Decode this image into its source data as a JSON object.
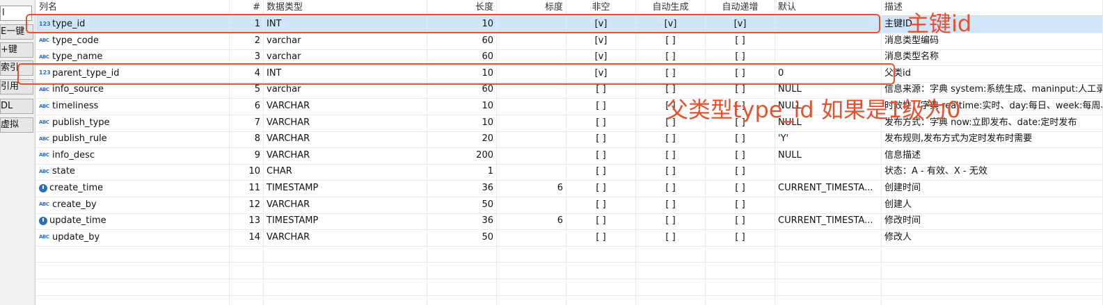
{
  "sidebar": {
    "field_value": "l",
    "items": [
      "E一键",
      "+键",
      "索引",
      "引用",
      "DL",
      "虚拟"
    ]
  },
  "columns": [
    "列名",
    "#",
    "数据类型",
    "长度",
    "标度",
    "非空",
    "自动生成",
    "自动递增",
    "默认",
    "描述"
  ],
  "rows": [
    {
      "icon": "number-type-icon",
      "name": "type_id",
      "num": "1",
      "type": "INT",
      "length": "10",
      "scale": "",
      "notnull": "[v]",
      "autogen": "[v]",
      "autoinc": "[v]",
      "default": "",
      "desc": "主键ID",
      "selected": true
    },
    {
      "icon": "text-type-icon",
      "name": "type_code",
      "num": "2",
      "type": "varchar",
      "length": "60",
      "scale": "",
      "notnull": "[v]",
      "autogen": "[ ]",
      "autoinc": "[ ]",
      "default": "",
      "desc": "消息类型编码"
    },
    {
      "icon": "text-type-icon",
      "name": "type_name",
      "num": "3",
      "type": "varchar",
      "length": "60",
      "scale": "",
      "notnull": "[v]",
      "autogen": "[ ]",
      "autoinc": "[ ]",
      "default": "",
      "desc": "消息类型名称"
    },
    {
      "icon": "number-type-icon",
      "name": "parent_type_id",
      "num": "4",
      "type": "INT",
      "length": "10",
      "scale": "",
      "notnull": "[v]",
      "autogen": "[ ]",
      "autoinc": "[ ]",
      "default": "0",
      "desc": "父类id"
    },
    {
      "icon": "text-type-icon",
      "name": "info_source",
      "num": "5",
      "type": "varchar",
      "length": "60",
      "scale": "",
      "notnull": "[ ]",
      "autogen": "[ ]",
      "autoinc": "[ ]",
      "default": "NULL",
      "desc": "信息来源：字典 system:系统生成、maninput:人工录入、th"
    },
    {
      "icon": "text-type-icon",
      "name": "timeliness",
      "num": "6",
      "type": "VARCHAR",
      "length": "10",
      "scale": "",
      "notnull": "[ ]",
      "autogen": "[ ]",
      "autoinc": "[ ]",
      "default": "NULL",
      "desc": "时效性：字典 realtime:实时、day:每日、week:每周、month"
    },
    {
      "icon": "text-type-icon",
      "name": "publish_type",
      "num": "7",
      "type": "VARCHAR",
      "length": "10",
      "scale": "",
      "notnull": "[ ]",
      "autogen": "[ ]",
      "autoinc": "[ ]",
      "default": "NULL",
      "desc": "发布方式：字典 now:立即发布、date:定时发布"
    },
    {
      "icon": "text-type-icon",
      "name": "publish_rule",
      "num": "8",
      "type": "VARCHAR",
      "length": "20",
      "scale": "",
      "notnull": "[ ]",
      "autogen": "[ ]",
      "autoinc": "[ ]",
      "default": "'Y'",
      "desc": "发布规则,发布方式为定时发布时需要"
    },
    {
      "icon": "text-type-icon",
      "name": "info_desc",
      "num": "9",
      "type": "VARCHAR",
      "length": "200",
      "scale": "",
      "notnull": "[ ]",
      "autogen": "[ ]",
      "autoinc": "[ ]",
      "default": "NULL",
      "desc": "信息描述"
    },
    {
      "icon": "text-type-icon",
      "name": "state",
      "num": "10",
      "type": "CHAR",
      "length": "1",
      "scale": "",
      "notnull": "[ ]",
      "autogen": "[ ]",
      "autoinc": "[ ]",
      "default": "",
      "desc": "状态：A - 有效、X - 无效"
    },
    {
      "icon": "clock-type-icon",
      "name": "create_time",
      "num": "11",
      "type": "TIMESTAMP",
      "length": "36",
      "scale": "6",
      "notnull": "[ ]",
      "autogen": "[ ]",
      "autoinc": "[ ]",
      "default": "CURRENT_TIMESTA...",
      "desc": "创建时间"
    },
    {
      "icon": "text-type-icon",
      "name": "create_by",
      "num": "12",
      "type": "VARCHAR",
      "length": "50",
      "scale": "",
      "notnull": "[ ]",
      "autogen": "[ ]",
      "autoinc": "[ ]",
      "default": "",
      "desc": "创建人"
    },
    {
      "icon": "clock-type-icon",
      "name": "update_time",
      "num": "13",
      "type": "TIMESTAMP",
      "length": "36",
      "scale": "6",
      "notnull": "[ ]",
      "autogen": "[ ]",
      "autoinc": "[ ]",
      "default": "CURRENT_TIMESTA...",
      "desc": "修改时间"
    },
    {
      "icon": "text-type-icon",
      "name": "update_by",
      "num": "14",
      "type": "VARCHAR",
      "length": "50",
      "scale": "",
      "notnull": "[ ]",
      "autogen": "[ ]",
      "autoinc": "[ ]",
      "default": "",
      "desc": "修改人"
    }
  ],
  "icon_glyphs": {
    "text": "ABC",
    "number": "123"
  },
  "annotations": {
    "primary_key": "主键id",
    "parent_note": "父类型type_id 如果是1级为0",
    "color": "#e8502d"
  }
}
